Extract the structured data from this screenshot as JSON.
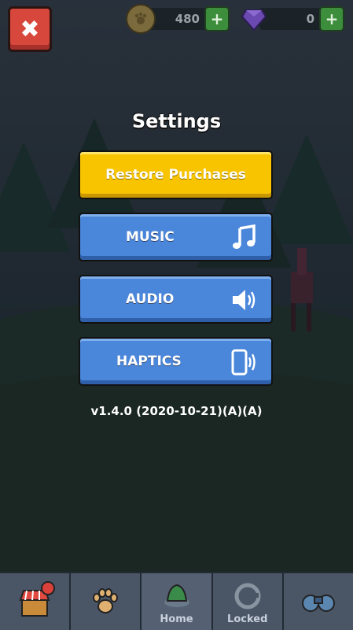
{
  "currency": {
    "coins": "480",
    "gems": "0",
    "plus": "+"
  },
  "close_label": "✖",
  "settings": {
    "title": "Settings",
    "restore_label": "Restore Purchases",
    "music_label": "MUSIC",
    "audio_label": "AUDIO",
    "haptics_label": "HAPTICS",
    "version": "v1.4.0 (2020-10-21)(A)(A)"
  },
  "tabs": {
    "home_label": "Home",
    "locked_label": "Locked"
  },
  "icons": {
    "music": "music-note-icon",
    "audio": "speaker-icon",
    "haptics": "phone-vibrate-icon"
  },
  "colors": {
    "restore": "#f8c400",
    "toggle": "#4a86d9",
    "close": "#d8473b",
    "plus": "#3c8d3c"
  }
}
